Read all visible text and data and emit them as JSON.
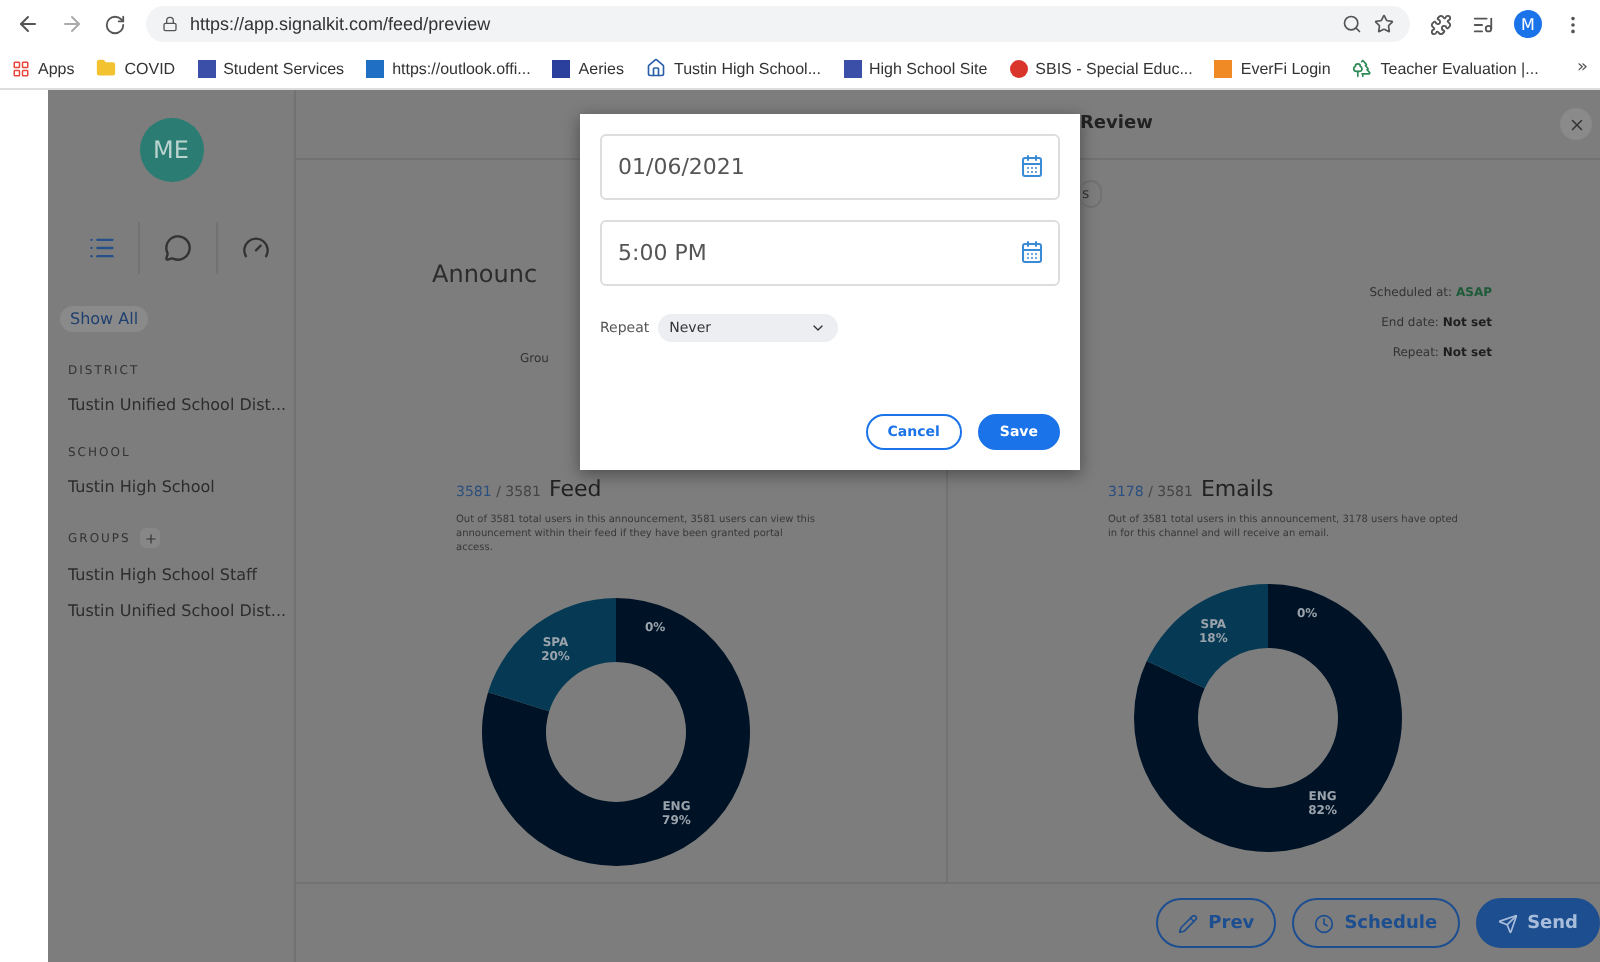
{
  "browser": {
    "url": "https://app.signalkit.com/feed/preview",
    "avatar": "M",
    "bookmarks": [
      {
        "label": "Apps",
        "kind": "grid",
        "color": "#e8453c"
      },
      {
        "label": "COVID",
        "kind": "folder",
        "color": "#f2c230"
      },
      {
        "label": "Student Services",
        "kind": "square",
        "color": "#3b4ea8"
      },
      {
        "label": "https://outlook.offi...",
        "kind": "square",
        "color": "#1f6fc5"
      },
      {
        "label": "Aeries",
        "kind": "square",
        "color": "#2b3f9c"
      },
      {
        "label": "Tustin High School...",
        "kind": "house",
        "color": "#2b5fa8"
      },
      {
        "label": "High School Site",
        "kind": "square",
        "color": "#3b4ea8"
      },
      {
        "label": "SBIS - Special Educ...",
        "kind": "circle",
        "color": "#d9352b"
      },
      {
        "label": "EverFi Login",
        "kind": "square",
        "color": "#f08a24"
      },
      {
        "label": "Teacher Evaluation |...",
        "kind": "tree",
        "color": "#2e8b57"
      }
    ],
    "more": "»"
  },
  "sidebar": {
    "initials": "ME",
    "tabs": [
      {
        "kind": "list",
        "selected": true
      },
      {
        "kind": "chat",
        "selected": false
      },
      {
        "kind": "gauge",
        "selected": false
      }
    ],
    "filter": "Show All",
    "sections": [
      {
        "heading": "DISTRICT",
        "add_button": false,
        "items": [
          "Tustin Unified School Dist..."
        ]
      },
      {
        "heading": "SCHOOL",
        "add_button": false,
        "items": [
          "Tustin High School"
        ]
      },
      {
        "heading": "GROUPS",
        "add_button": true,
        "items": [
          "Tustin High School Staff",
          "Tustin Unified School Dist..."
        ]
      }
    ]
  },
  "header": {
    "title": "Review"
  },
  "summary": {
    "pill": "s",
    "title": "Announc",
    "groups": "Grou",
    "details": [
      {
        "label": "Scheduled at:",
        "value": "ASAP",
        "kind": "accent"
      },
      {
        "label": "End date:",
        "value": "Not set",
        "kind": "plain"
      },
      {
        "label": "Repeat:",
        "value": "Not set",
        "kind": "plain"
      }
    ]
  },
  "channels": [
    {
      "count": "3581",
      "total": "/ 3581",
      "title": "Feed",
      "text": "Out of 3581 total users in this announcement, 3581 users can view this announcement within their feed if they have been granted portal access.",
      "chart_data": {
        "type": "donut",
        "categories": [
          "ENG",
          "SPA",
          null
        ],
        "values": [
          79,
          20,
          0
        ],
        "value_labels": [
          "79%",
          "20%",
          "0%"
        ]
      }
    },
    {
      "count": "3178",
      "total": "/ 3581",
      "title": "Emails",
      "text": "Out of 3581 total users in this announcement, 3178 users have opted in for this channel and will receive an email.",
      "chart_data": {
        "type": "donut",
        "categories": [
          "ENG",
          "SPA",
          null
        ],
        "values": [
          82,
          18,
          0
        ],
        "value_labels": [
          "82%",
          "18%",
          "0%"
        ]
      }
    }
  ],
  "footer": [
    {
      "label": "Prev",
      "kind": "outline"
    },
    {
      "label": "Schedule",
      "kind": "outline"
    },
    {
      "label": "Send",
      "kind": "primary"
    }
  ],
  "dialog": {
    "date": "01/06/2021",
    "time": "5:00 PM",
    "repeat_label": "Repeat",
    "repeat": "Never",
    "buttons": [
      {
        "label": "Cancel",
        "kind": "outline"
      },
      {
        "label": "Save",
        "kind": "primary"
      }
    ]
  }
}
